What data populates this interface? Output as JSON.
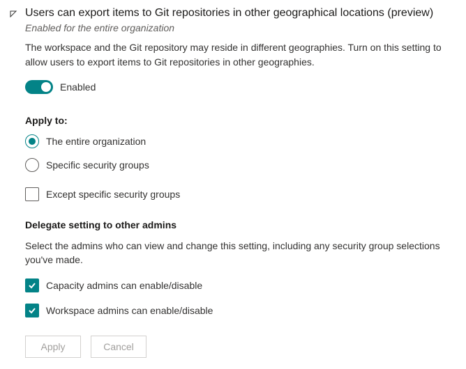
{
  "title": "Users can export items to Git repositories in other geographical locations (preview)",
  "subtitle": "Enabled for the entire organization",
  "description": "The workspace and the Git repository may reside in different geographies. Turn on this setting to allow users to export items to Git repositories in other geographies.",
  "toggle": {
    "label": "Enabled"
  },
  "apply": {
    "label": "Apply to:",
    "options": {
      "entire": "The entire organization",
      "specific": "Specific security groups",
      "except": "Except specific security groups"
    }
  },
  "delegate": {
    "label": "Delegate setting to other admins",
    "description": "Select the admins who can view and change this setting, including any security group selections you've made.",
    "options": {
      "capacity": "Capacity admins can enable/disable",
      "workspace": "Workspace admins can enable/disable"
    }
  },
  "buttons": {
    "apply": "Apply",
    "cancel": "Cancel"
  }
}
